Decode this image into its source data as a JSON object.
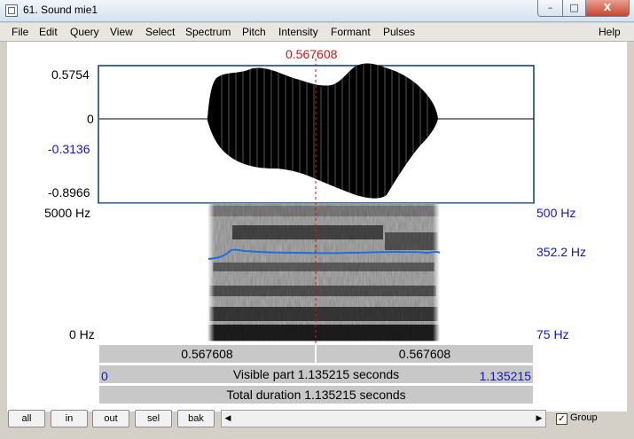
{
  "window": {
    "title": "61. Sound mie1",
    "min_glyph": "–",
    "max_glyph": "□",
    "close_glyph": "X"
  },
  "menu": [
    "File",
    "Edit",
    "Query",
    "View",
    "Select",
    "Spectrum",
    "Pitch",
    "Intensity",
    "Formant",
    "Pulses",
    "Help"
  ],
  "cursor": {
    "time": "0.567608"
  },
  "waveform": {
    "top": "0.5754",
    "zero": "0",
    "cursor_value": "-0.3136",
    "bottom": "-0.8966"
  },
  "spectrogram": {
    "freq_top": "5000 Hz",
    "freq_bottom": "0 Hz",
    "pitch_top": "500 Hz",
    "pitch_value": "352.2 Hz",
    "pitch_bottom": "75 Hz"
  },
  "time_bars": {
    "left_segment": "0.567608",
    "right_segment": "0.567608",
    "visible_start": "0",
    "visible_label": "Visible part 1.135215 seconds",
    "visible_end": "1.135215",
    "total_label": "Total duration 1.135215 seconds"
  },
  "buttons": {
    "all": "all",
    "in": "in",
    "out": "out",
    "sel": "sel",
    "bak": "bak"
  },
  "scroll": {
    "left_arrow": "◀",
    "right_arrow": "▶"
  },
  "group": {
    "label": "Group",
    "checked": true,
    "check_glyph": "✓"
  },
  "colors": {
    "pitch_curve": "#1e6fe0",
    "cursor": "#d21414",
    "blue_text": "#1414c8"
  }
}
